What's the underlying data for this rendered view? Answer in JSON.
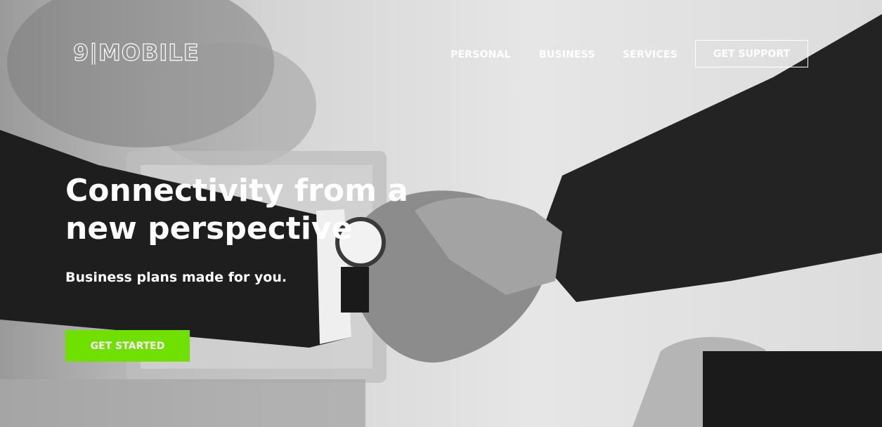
{
  "brand": {
    "name": "9|MOBILE"
  },
  "nav": {
    "items": [
      "PERSONAL",
      "BUSINESS",
      "SERVICES"
    ],
    "support_label": "GET SUPPORT"
  },
  "hero": {
    "headline": "Connectivity from a new perspective",
    "subheadline": "Business plans made for you.",
    "cta_label": "GET STARTED"
  },
  "colors": {
    "accent": "#6fe000",
    "text": "#ffffff"
  }
}
